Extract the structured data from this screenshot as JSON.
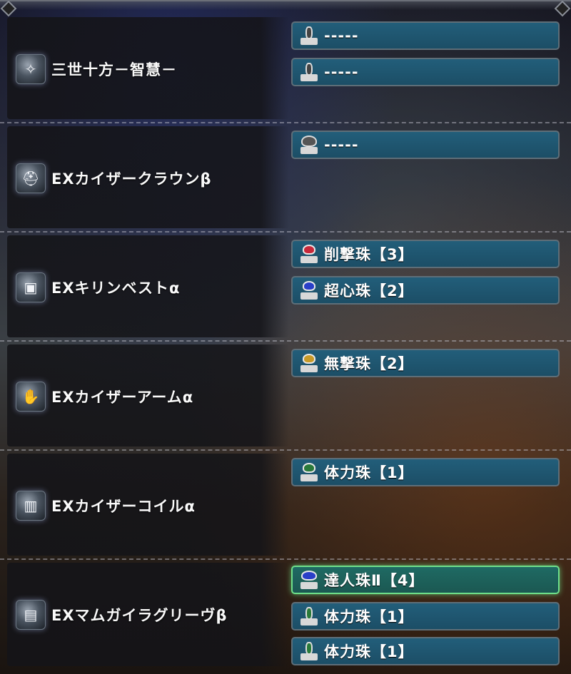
{
  "colors": {
    "slot_bg": "#1c4e66",
    "slot_highlight_border": "#6fe08a",
    "gem_red": "#c8283a",
    "gem_blue": "#2a3fc8",
    "gem_gold": "#c89a28",
    "gem_green": "#2a7a3a"
  },
  "equipment": [
    {
      "name": "三世十方－智慧－",
      "icon": "charm-icon",
      "slots": [
        {
          "label": "-----",
          "gem": "empty-slot-lv1",
          "color": "#444444"
        },
        {
          "label": "-----",
          "gem": "empty-slot-lv1",
          "color": "#444444"
        }
      ]
    },
    {
      "name": "EXカイザークラウンβ",
      "icon": "helm-icon",
      "slots": [
        {
          "label": "-----",
          "gem": "empty-slot-lv3",
          "color": "#555555"
        }
      ]
    },
    {
      "name": "EXキリンベストα",
      "icon": "chest-icon",
      "slots": [
        {
          "label": "削撃珠【3】",
          "gem": "red-decoration",
          "color": "#c8283a"
        },
        {
          "label": "超心珠【2】",
          "gem": "blue-decoration",
          "color": "#2a3fc8"
        }
      ]
    },
    {
      "name": "EXカイザーアームα",
      "icon": "arm-icon",
      "slots": [
        {
          "label": "無撃珠【2】",
          "gem": "gold-decoration",
          "color": "#c89a28"
        }
      ]
    },
    {
      "name": "EXカイザーコイルα",
      "icon": "waist-icon",
      "slots": [
        {
          "label": "体力珠【1】",
          "gem": "green-decoration",
          "color": "#2a7a3a"
        }
      ]
    },
    {
      "name": "EXマムガイラグリーヴβ",
      "icon": "legs-icon",
      "slots": [
        {
          "label": "達人珠Ⅱ【4】",
          "gem": "blue-decoration",
          "color": "#2a3fc8",
          "highlight": true
        },
        {
          "label": "体力珠【1】",
          "gem": "green-decoration",
          "color": "#2a7a3a"
        },
        {
          "label": "体力珠【1】",
          "gem": "green-decoration",
          "color": "#2a7a3a"
        }
      ]
    }
  ]
}
